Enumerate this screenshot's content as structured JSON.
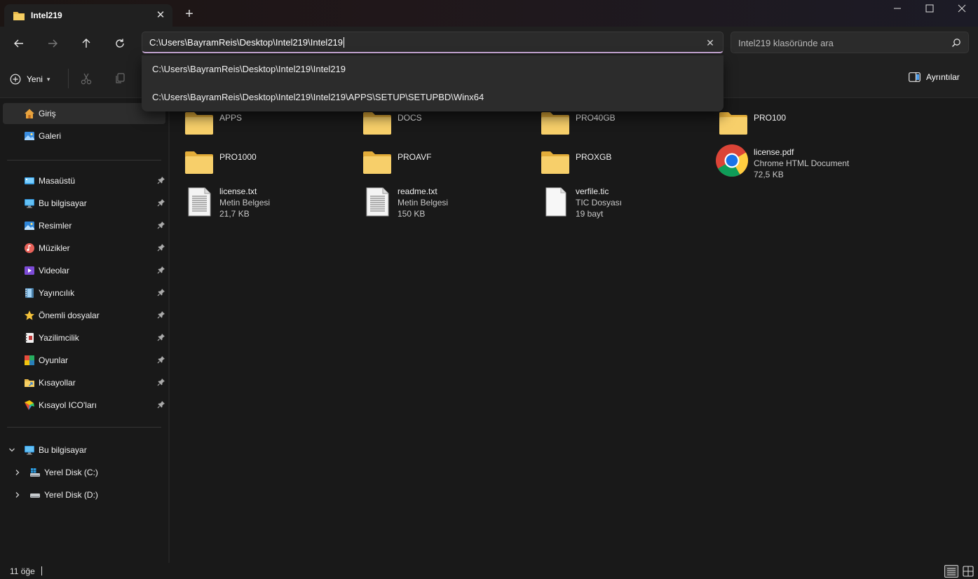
{
  "window": {
    "tab_title": "Intel219",
    "tab_close": "✕",
    "new_tab": "+"
  },
  "nav": {
    "address_value": "C:\\Users\\BayramReis\\Desktop\\Intel219\\Intel219",
    "address_clear": "✕",
    "search_placeholder": "Intel219 klasöründe ara"
  },
  "toolbar": {
    "new_label": "Yeni",
    "details_label": "Ayrıntılar"
  },
  "suggestions": [
    "C:\\Users\\BayramReis\\Desktop\\Intel219\\Intel219",
    "C:\\Users\\BayramReis\\Desktop\\Intel219\\Intel219\\APPS\\SETUP\\SETUPBD\\Winx64"
  ],
  "sidebar": {
    "home": "Giriş",
    "gallery": "Galeri",
    "quick_access": [
      {
        "label": "Masaüstü",
        "icon": "desktop-icon"
      },
      {
        "label": "Bu bilgisayar",
        "icon": "computer-icon"
      },
      {
        "label": "Resimler",
        "icon": "pictures-icon"
      },
      {
        "label": "Müzikler",
        "icon": "music-icon"
      },
      {
        "label": "Videolar",
        "icon": "videos-icon"
      },
      {
        "label": "Yayıncılık",
        "icon": "film-icon"
      },
      {
        "label": "Önemli dosyalar",
        "icon": "star-icon"
      },
      {
        "label": "Yazilimcilik",
        "icon": "notebook-icon"
      },
      {
        "label": "Oyunlar",
        "icon": "games-icon"
      },
      {
        "label": "Kısayollar",
        "icon": "shortcuts-folder-icon"
      },
      {
        "label": "Kısayol ICO'ları",
        "icon": "colorful-icon"
      }
    ],
    "this_pc": "Bu bilgisayar",
    "drives": [
      "Yerel Disk (C:)",
      "Yerel Disk (D:)"
    ]
  },
  "files": [
    {
      "name": "APPS",
      "type": "",
      "size": "",
      "kind": "folder"
    },
    {
      "name": "DOCS",
      "type": "",
      "size": "",
      "kind": "folder"
    },
    {
      "name": "PRO40GB",
      "type": "",
      "size": "",
      "kind": "folder"
    },
    {
      "name": "PRO100",
      "type": "",
      "size": "",
      "kind": "folder"
    },
    {
      "name": "PRO1000",
      "type": "",
      "size": "",
      "kind": "folder"
    },
    {
      "name": "PROAVF",
      "type": "",
      "size": "",
      "kind": "folder"
    },
    {
      "name": "PROXGB",
      "type": "",
      "size": "",
      "kind": "folder"
    },
    {
      "name": "license.pdf",
      "type": "Chrome HTML Document",
      "size": "72,5 KB",
      "kind": "chrome"
    },
    {
      "name": "license.txt",
      "type": "Metin Belgesi",
      "size": "21,7 KB",
      "kind": "text"
    },
    {
      "name": "readme.txt",
      "type": "Metin Belgesi",
      "size": "150 KB",
      "kind": "text"
    },
    {
      "name": "verfile.tic",
      "type": "TIC Dosyası",
      "size": "19 bayt",
      "kind": "blank"
    }
  ],
  "status": {
    "item_count": "11 öğe"
  },
  "colors": {
    "accent": "#c8a9d6",
    "folder": "#f4c95d",
    "background": "#191919"
  }
}
